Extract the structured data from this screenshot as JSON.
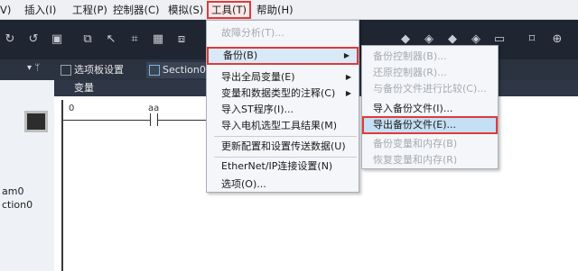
{
  "menubar": {
    "items": [
      "V)",
      "插入(I)",
      "工程(P)",
      "控制器(C)",
      "模拟(S)",
      "工具(T)",
      "帮助(H)"
    ]
  },
  "toolbar": {
    "icons": [
      "redo-icon",
      "undo-icon",
      "clipboard-icon",
      "window-icon",
      "pointer-icon",
      "crossbar-icon",
      "grid-icon",
      "link-icon",
      "dots-icon",
      "module-icon",
      "module2-icon",
      "module3-icon",
      "module4-icon",
      "monitor-icon",
      "target-icon",
      "zoom-icon"
    ]
  },
  "leftpane": {
    "items": [
      "am0",
      "ction0"
    ],
    "pin": "▾ ᛘ"
  },
  "tabs": [
    {
      "label": "选项板设置"
    },
    {
      "label": "Section0 -"
    }
  ],
  "editor": {
    "var_header": "变量",
    "rung_number": "0",
    "contact_label": "aa"
  },
  "tools_menu": {
    "items": [
      {
        "label": "故障分析(T)...",
        "disabled": true,
        "submenu": false
      },
      {
        "label": "备份(B)",
        "disabled": false,
        "submenu": true,
        "highlight": true
      },
      {
        "label": "导出全局变量(E)",
        "disabled": false,
        "submenu": true
      },
      {
        "label": "变量和数据类型的注释(C)",
        "disabled": false,
        "submenu": true
      },
      {
        "label": "导入ST程序(I)...",
        "disabled": false,
        "submenu": false
      },
      {
        "label": "导入电机选型工具结果(M)",
        "disabled": false,
        "submenu": false
      },
      {
        "label": "更新配置和设置传送数据(U)",
        "disabled": false,
        "submenu": false
      },
      {
        "label": "EtherNet/IP连接设置(N)",
        "disabled": false,
        "submenu": false
      },
      {
        "label": "选项(O)...",
        "disabled": false,
        "submenu": false
      }
    ]
  },
  "backup_menu": {
    "items": [
      {
        "label": "备份控制器(B)...",
        "disabled": true
      },
      {
        "label": "还原控制器(R)...",
        "disabled": true
      },
      {
        "label": "与备份文件进行比较(C)...",
        "disabled": true
      },
      {
        "label": "导入备份文件(I)...",
        "disabled": false
      },
      {
        "label": "导出备份文件(E)...",
        "disabled": false,
        "highlight": true
      },
      {
        "label": "备份变量和内存(B)",
        "disabled": true
      },
      {
        "label": "恢复变量和内存(R)",
        "disabled": true
      }
    ]
  },
  "colors": {
    "highlight_border": "#e03a3a",
    "toolbar_bg": "#1f2631",
    "menu_bg": "#f4f6f9"
  }
}
